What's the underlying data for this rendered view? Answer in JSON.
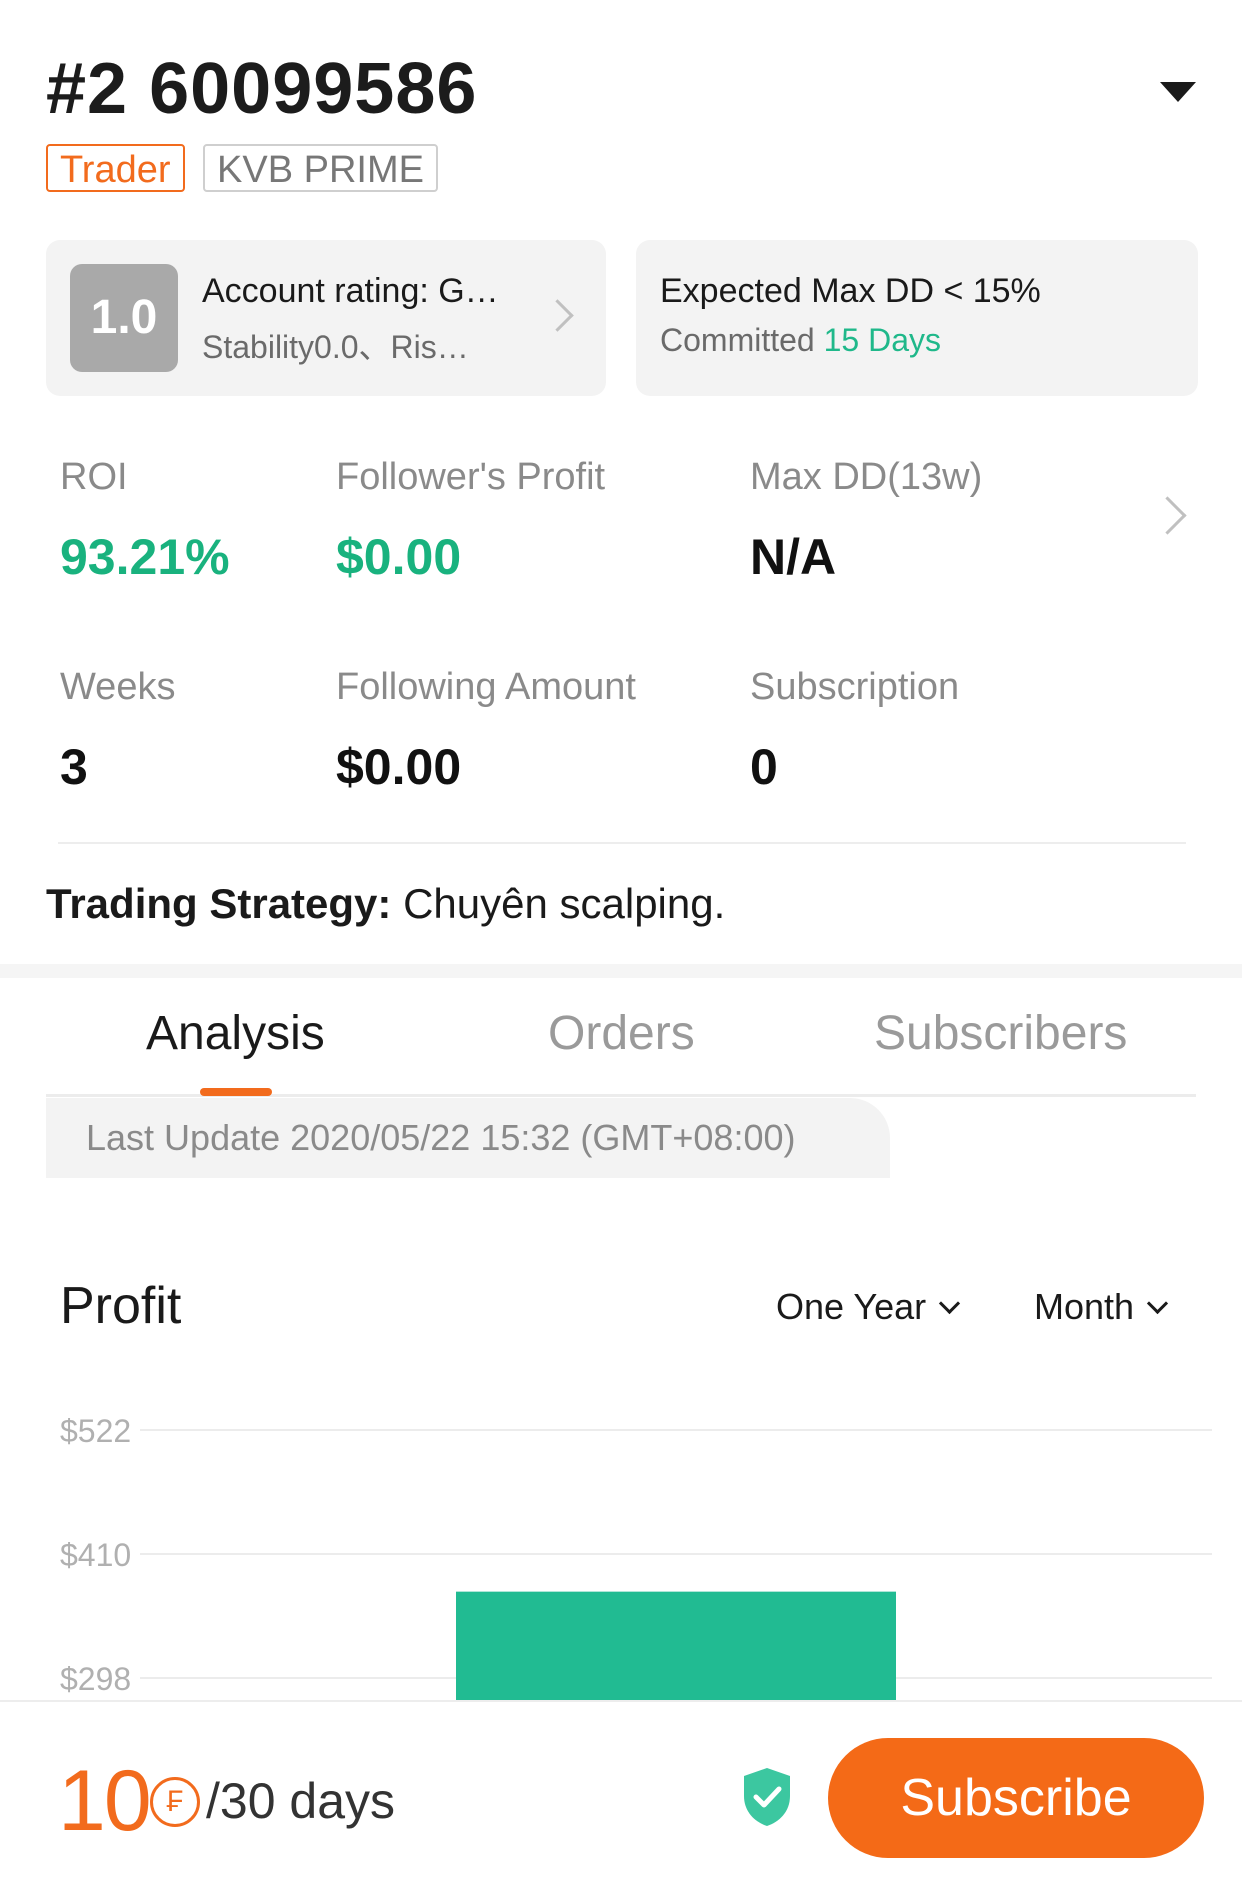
{
  "header": {
    "title": "#2 60099586",
    "tags": [
      "Trader",
      "KVB PRIME"
    ]
  },
  "cards": {
    "rating": {
      "score": "1.0",
      "line1": "Account rating: G…",
      "line2": "Stability0.0、Ris…"
    },
    "commitment": {
      "line1": "Expected Max DD < 15%",
      "line2_prefix": "Committed",
      "line2_value": "15 Days"
    }
  },
  "stats": [
    {
      "label": "ROI",
      "value": "93.21%"
    },
    {
      "label": "Follower's Profit",
      "value": "$0.00"
    },
    {
      "label": "Max DD(13w)",
      "value": "N/A"
    },
    {
      "label": "Weeks",
      "value": "3"
    },
    {
      "label": "Following Amount",
      "value": "$0.00"
    },
    {
      "label": "Subscription",
      "value": "0"
    }
  ],
  "strategy": {
    "label": "Trading Strategy:",
    "text": "Chuyên scalping."
  },
  "tabs": [
    "Analysis",
    "Orders",
    "Subscribers"
  ],
  "active_tab": "Analysis",
  "last_update": "Last Update 2020/05/22 15:32 (GMT+08:00)",
  "profit_section": {
    "title": "Profit",
    "range_selector": "One Year",
    "period_selector": "Month"
  },
  "chart_data": {
    "type": "bar",
    "y_ticks": [
      "$522",
      "$410",
      "$298"
    ],
    "y_tick_values": [
      522,
      410,
      298
    ],
    "values": [
      376
    ],
    "grid": true
  },
  "bottom_bar": {
    "price": "10",
    "coin_symbol": "₣",
    "period": "/30 days",
    "subscribe_label": "Subscribe"
  },
  "colors": {
    "accent_orange": "#f26b1d",
    "accent_green": "#19b27e",
    "bar_green": "#21bb92",
    "shield_green": "#3cc7a0"
  },
  "icons": [
    "dropdown-caret-icon",
    "chevron-right-icon",
    "chevron-down-icon",
    "coin-icon",
    "shield-check-icon"
  ]
}
